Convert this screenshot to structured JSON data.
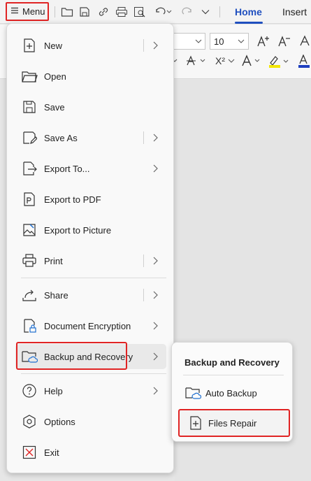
{
  "toolbar": {
    "menu_label": "Menu",
    "tabs": [
      {
        "label": "Home",
        "active": true
      },
      {
        "label": "Insert",
        "active": false
      }
    ],
    "accent_color": "#1f4fbf",
    "highlight_color": "#e02424"
  },
  "ribbon": {
    "font_size": "10",
    "subscript_label": "X²"
  },
  "menu": {
    "items": [
      {
        "label": "New",
        "icon": "new-file-icon",
        "submenu": true
      },
      {
        "label": "Open",
        "icon": "folder-open-icon",
        "submenu": false
      },
      {
        "label": "Save",
        "icon": "save-icon",
        "submenu": false
      },
      {
        "label": "Save As",
        "icon": "save-as-icon",
        "submenu": true
      },
      {
        "label": "Export To...",
        "icon": "export-icon",
        "submenu": true
      },
      {
        "label": "Export to PDF",
        "icon": "pdf-icon",
        "submenu": false
      },
      {
        "label": "Export to Picture",
        "icon": "picture-icon",
        "submenu": false
      },
      {
        "label": "Print",
        "icon": "printer-icon",
        "submenu": true
      },
      {
        "label": "Share",
        "icon": "share-icon",
        "submenu": true
      },
      {
        "label": "Document Encryption",
        "icon": "encryption-icon",
        "submenu": true
      },
      {
        "label": "Backup and Recovery",
        "icon": "backup-folder-icon",
        "submenu": true
      },
      {
        "label": "Help",
        "icon": "help-icon",
        "submenu": true
      },
      {
        "label": "Options",
        "icon": "options-icon",
        "submenu": false
      },
      {
        "label": "Exit",
        "icon": "exit-icon",
        "submenu": false
      }
    ]
  },
  "submenu": {
    "title": "Backup and Recovery",
    "items": [
      {
        "label": "Auto Backup",
        "icon": "auto-backup-icon"
      },
      {
        "label": "Files Repair",
        "icon": "files-repair-icon"
      }
    ]
  }
}
